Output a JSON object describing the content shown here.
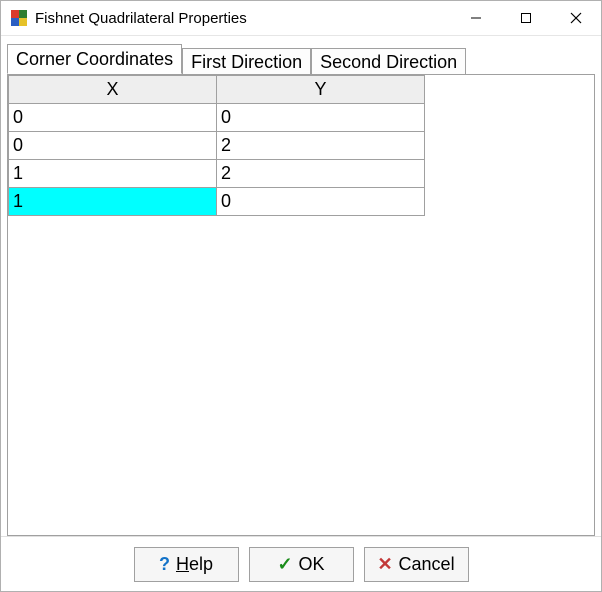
{
  "window": {
    "title": "Fishnet Quadrilateral Properties"
  },
  "tabs": [
    {
      "label": "Corner Coordinates",
      "active": true
    },
    {
      "label": "First Direction",
      "active": false
    },
    {
      "label": "Second Direction",
      "active": false
    }
  ],
  "grid": {
    "columns": {
      "x": "X",
      "y": "Y"
    },
    "rows": [
      {
        "x": "0",
        "y": "0",
        "x_selected": false
      },
      {
        "x": "0",
        "y": "2",
        "x_selected": false
      },
      {
        "x": "1",
        "y": "2",
        "x_selected": false
      },
      {
        "x": "1",
        "y": "0",
        "x_selected": true
      }
    ]
  },
  "buttons": {
    "help": {
      "glyph": "?",
      "label_pre": "",
      "label_ul": "H",
      "label_post": "elp"
    },
    "ok": {
      "glyph": "✓",
      "label_pre": "OK",
      "label_ul": "",
      "label_post": ""
    },
    "cancel": {
      "glyph": "✕",
      "label_pre": "Cancel",
      "label_ul": "",
      "label_post": ""
    }
  }
}
